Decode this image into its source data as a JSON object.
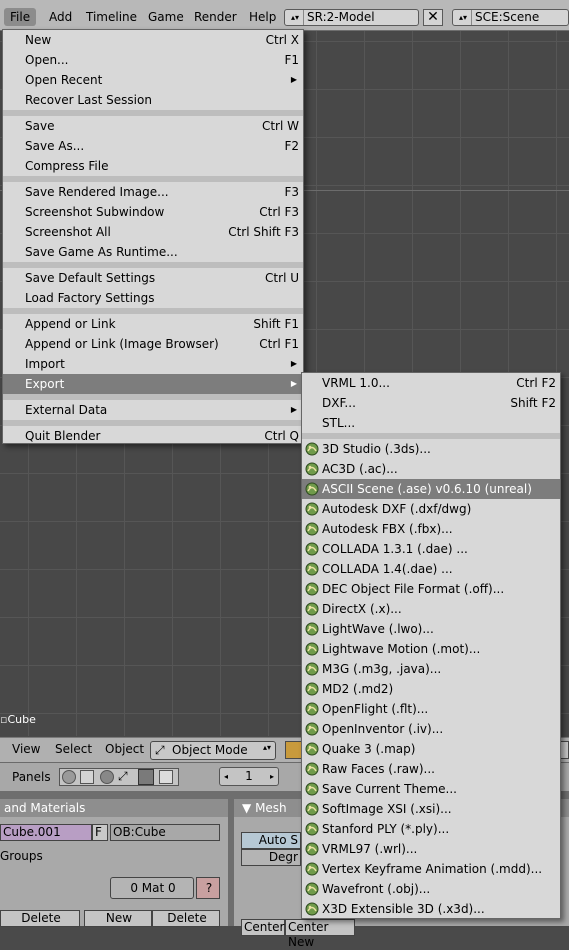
{
  "topbar": {
    "menus": [
      "File",
      "Add",
      "Timeline",
      "Game",
      "Render",
      "Help"
    ],
    "screen": "SR:2-Model",
    "scene": "SCE:Scene",
    "close": "✕"
  },
  "viewport": {
    "label": "Cube"
  },
  "viewport_header": {
    "view": "View",
    "select": "Select",
    "object": "Object",
    "mode": "Object Mode"
  },
  "buttons_window": {
    "panels_label": "Panels",
    "page_number": "1",
    "links_title": "and Materials",
    "mesh_title": "Mesh",
    "mesh_name": "Cube.001",
    "f_label": "F",
    "ob_name": "OB:Cube",
    "groups": "Groups",
    "mat": "0 Mat 0",
    "question": "?",
    "delete1": "Delete",
    "new": "New",
    "delete2": "Delete",
    "auto_smooth": "Auto S",
    "degr": "Degr",
    "center": "Center",
    "center_new": "Center New"
  },
  "file_menu": {
    "items": [
      {
        "label": "New",
        "shortcut": "Ctrl X"
      },
      {
        "label": "Open...",
        "shortcut": "F1"
      },
      {
        "label": "Open Recent",
        "submenu": true
      },
      {
        "label": "Recover Last Session"
      },
      {
        "sep": true
      },
      {
        "label": "Save",
        "shortcut": "Ctrl W"
      },
      {
        "label": "Save As...",
        "shortcut": "F2"
      },
      {
        "label": "Compress File"
      },
      {
        "sep": true
      },
      {
        "label": "Save Rendered Image...",
        "shortcut": "F3"
      },
      {
        "label": "Screenshot Subwindow",
        "shortcut": "Ctrl F3"
      },
      {
        "label": "Screenshot All",
        "shortcut": "Ctrl Shift F3"
      },
      {
        "label": "Save Game As Runtime..."
      },
      {
        "sep": true
      },
      {
        "label": "Save Default Settings",
        "shortcut": "Ctrl U"
      },
      {
        "label": "Load Factory Settings"
      },
      {
        "sep": true
      },
      {
        "label": "Append or Link",
        "shortcut": "Shift F1"
      },
      {
        "label": "Append or Link (Image Browser)",
        "shortcut": "Ctrl F1"
      },
      {
        "label": "Import",
        "submenu": true
      },
      {
        "label": "Export",
        "submenu": true,
        "highlighted": true
      },
      {
        "sep": true
      },
      {
        "label": "External Data",
        "submenu": true
      },
      {
        "sep": true
      },
      {
        "label": "Quit Blender",
        "shortcut": "Ctrl Q"
      }
    ]
  },
  "export_menu": {
    "items": [
      {
        "label": "VRML 1.0...",
        "shortcut": "Ctrl F2"
      },
      {
        "label": "DXF...",
        "shortcut": "Shift F2"
      },
      {
        "label": "STL..."
      },
      {
        "sep": true
      },
      {
        "label": "3D Studio (.3ds)...",
        "script": true
      },
      {
        "label": "AC3D (.ac)...",
        "script": true
      },
      {
        "label": "ASCII Scene (.ase) v0.6.10 (unreal)",
        "script": true,
        "highlighted": true
      },
      {
        "label": "Autodesk DXF (.dxf/dwg)",
        "script": true
      },
      {
        "label": "Autodesk FBX (.fbx)...",
        "script": true
      },
      {
        "label": "COLLADA 1.3.1 (.dae) ...",
        "script": true
      },
      {
        "label": "COLLADA 1.4(.dae) ...",
        "script": true
      },
      {
        "label": "DEC Object File Format (.off)...",
        "script": true
      },
      {
        "label": "DirectX (.x)...",
        "script": true
      },
      {
        "label": "LightWave (.lwo)...",
        "script": true
      },
      {
        "label": "Lightwave Motion (.mot)...",
        "script": true
      },
      {
        "label": "M3G (.m3g, .java)...",
        "script": true
      },
      {
        "label": "MD2 (.md2)",
        "script": true
      },
      {
        "label": "OpenFlight (.flt)...",
        "script": true
      },
      {
        "label": "OpenInventor (.iv)...",
        "script": true
      },
      {
        "label": "Quake 3 (.map)",
        "script": true
      },
      {
        "label": "Raw Faces (.raw)...",
        "script": true
      },
      {
        "label": "Save Current Theme...",
        "script": true
      },
      {
        "label": "SoftImage XSI (.xsi)...",
        "script": true
      },
      {
        "label": "Stanford PLY (*.ply)...",
        "script": true
      },
      {
        "label": "VRML97 (.wrl)...",
        "script": true
      },
      {
        "label": "Vertex Keyframe Animation (.mdd)...",
        "script": true
      },
      {
        "label": "Wavefront (.obj)...",
        "script": true
      },
      {
        "label": "X3D Extensible 3D (.x3d)...",
        "script": true
      }
    ]
  }
}
